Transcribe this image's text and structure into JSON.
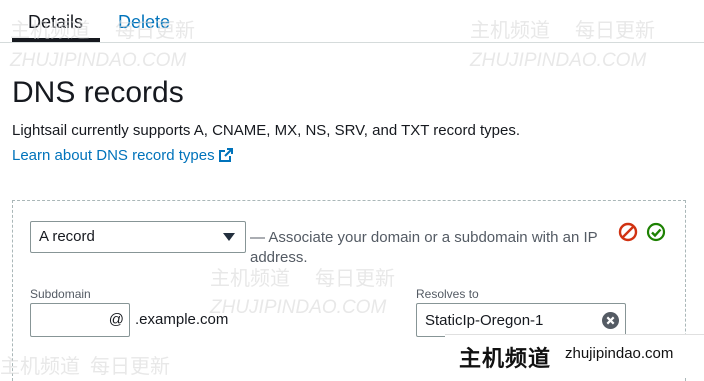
{
  "tabs": [
    {
      "label": "Details",
      "active": true
    },
    {
      "label": "Delete",
      "active": false
    }
  ],
  "page_title": "DNS records",
  "description": "Lightsail currently supports A, CNAME, MX, NS, SRV, and TXT record types.",
  "learn_link": "Learn about DNS record types",
  "record_form": {
    "record_type": "A record",
    "association_text": "— Associate your domain or a subdomain with an IP address.",
    "subdomain_label": "Subdomain",
    "subdomain_value": "",
    "at_symbol": "@",
    "domain_suffix": ".example.com",
    "resolves_to_label": "Resolves to",
    "resolves_to_value": "StaticIp-Oregon-1"
  },
  "watermark": {
    "cn_brand": "主机频道",
    "cn_sub": "每日更新",
    "en": "ZHUJIPINDAO.COM",
    "badge_cn": "主机频道",
    "badge_domain": "zhujipindao.com"
  },
  "colors": {
    "link": "#0073bb",
    "cancel": "#d13212",
    "confirm": "#1d8102"
  }
}
